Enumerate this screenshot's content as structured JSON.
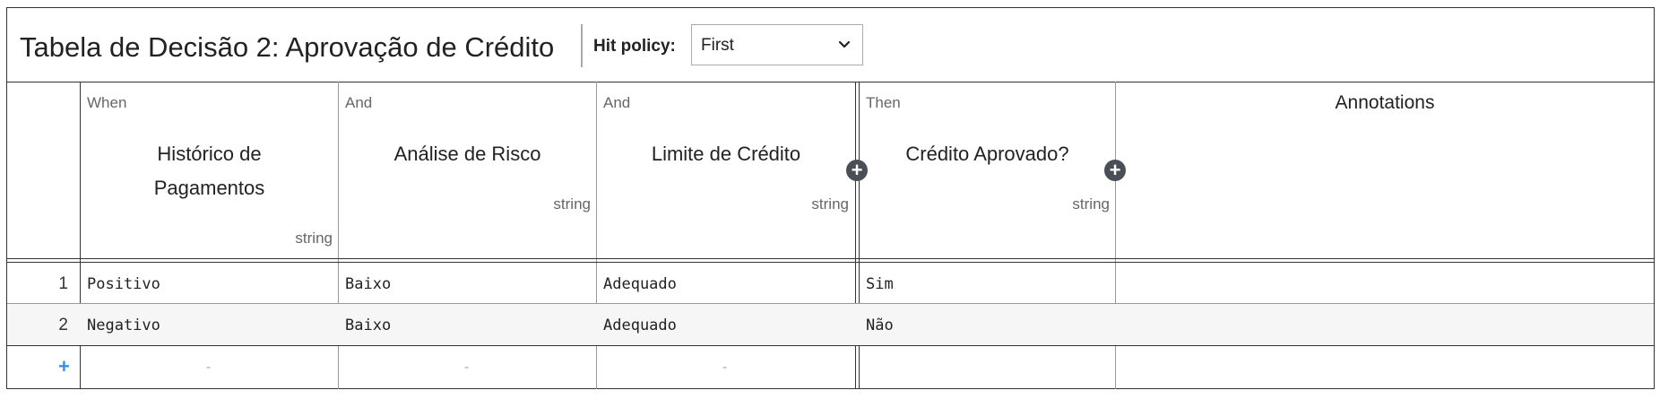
{
  "title": "Tabela de Decisão 2: Aprovação de Crédito",
  "hit_policy": {
    "label": "Hit policy:",
    "value": "First"
  },
  "columns": [
    {
      "kind": "When",
      "name_line1": "Histórico de",
      "name_line2": "Pagamentos",
      "type": "string"
    },
    {
      "kind": "And",
      "name_line1": "Análise de Risco",
      "name_line2": "",
      "type": "string"
    },
    {
      "kind": "And",
      "name_line1": "Limite de Crédito",
      "name_line2": "",
      "type": "string"
    },
    {
      "kind": "Then",
      "name_line1": "Crédito Aprovado?",
      "name_line2": "",
      "type": "string"
    }
  ],
  "annotations_header": "Annotations",
  "add_column_symbol": "+",
  "rows": [
    {
      "num": "1",
      "cells": [
        "Positivo",
        "Baixo",
        "Adequado",
        "Sim"
      ],
      "annotation": ""
    },
    {
      "num": "2",
      "cells": [
        "Negativo",
        "Baixo",
        "Adequado",
        "Não"
      ],
      "annotation": ""
    }
  ],
  "add_row_symbol": "+",
  "empty_placeholder": "-"
}
